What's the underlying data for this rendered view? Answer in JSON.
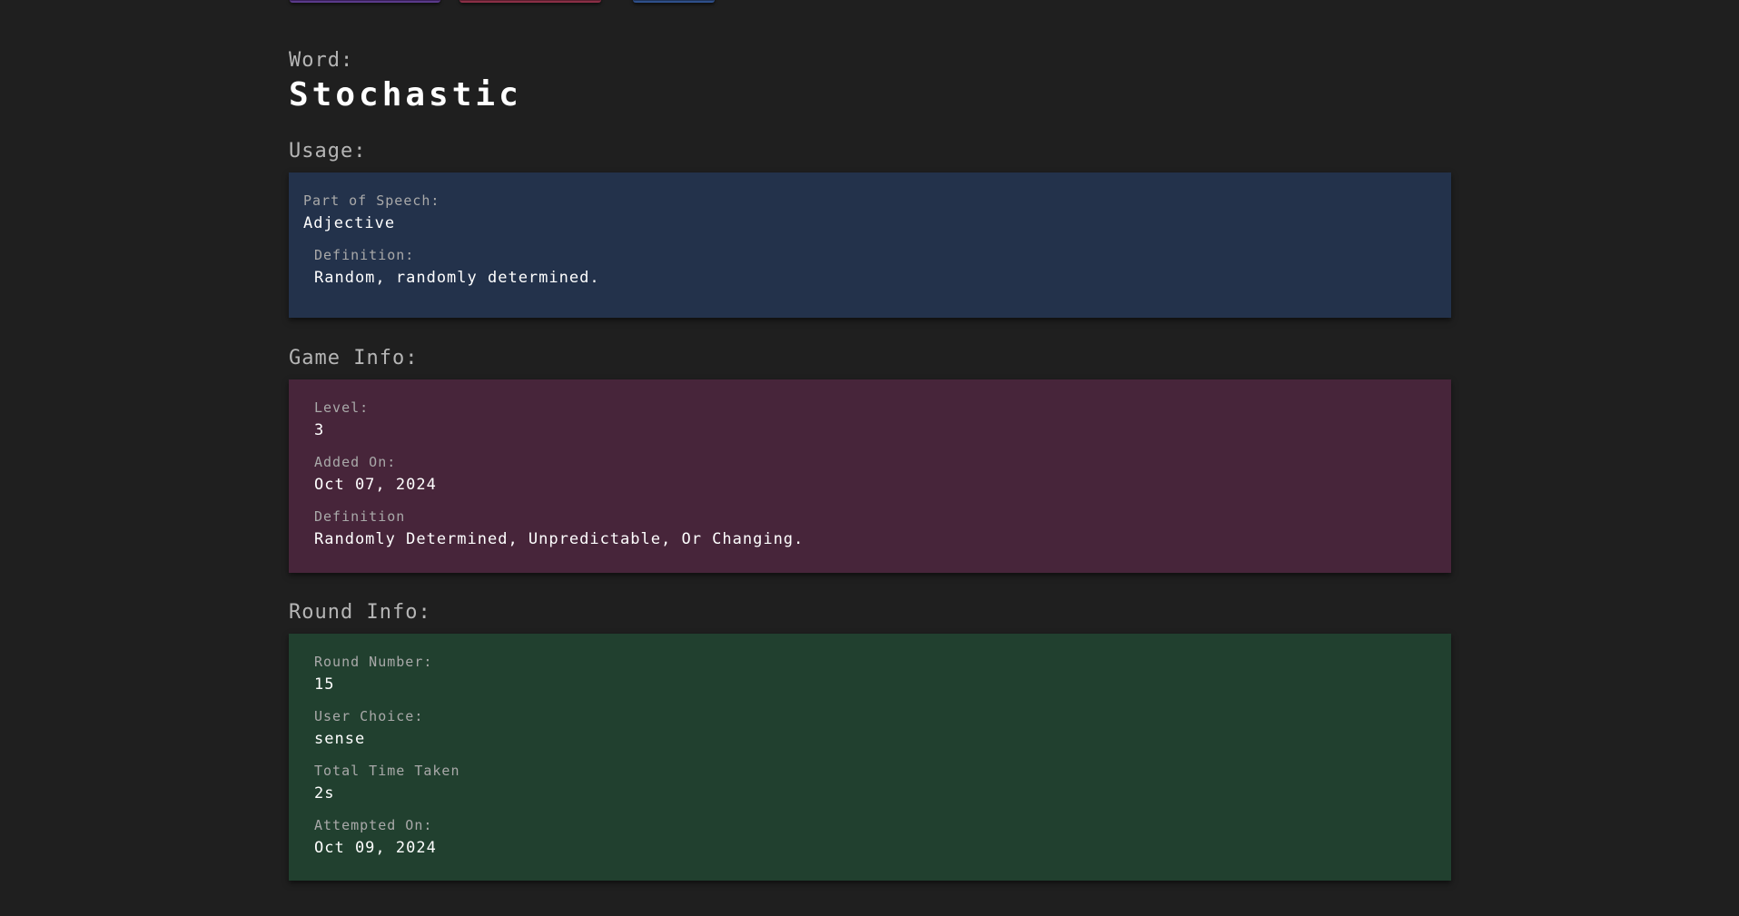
{
  "word": {
    "label": "Word:",
    "value": "Stochastic"
  },
  "usage": {
    "heading": "Usage:",
    "part_of_speech_label": "Part of Speech:",
    "part_of_speech_value": "Adjective",
    "definition_label": "Definition:",
    "definition_value": "Random, randomly determined."
  },
  "game_info": {
    "heading": "Game Info:",
    "level_label": "Level:",
    "level_value": "3",
    "added_on_label": "Added On:",
    "added_on_value": "Oct 07, 2024",
    "definition_label": "Definition",
    "definition_value": "Randomly Determined, Unpredictable, Or Changing."
  },
  "round_info": {
    "heading": "Round Info:",
    "round_number_label": "Round Number:",
    "round_number_value": "15",
    "user_choice_label": "User Choice:",
    "user_choice_value": "sense",
    "time_taken_label": "Total Time Taken",
    "time_taken_value": "2s",
    "attempted_on_label": "Attempted On:",
    "attempted_on_value": "Oct 09, 2024"
  },
  "colors": {
    "background": "#1f1f1f",
    "usage_card": "#23324b",
    "game_card": "#47253a",
    "round_card": "#21402f"
  }
}
